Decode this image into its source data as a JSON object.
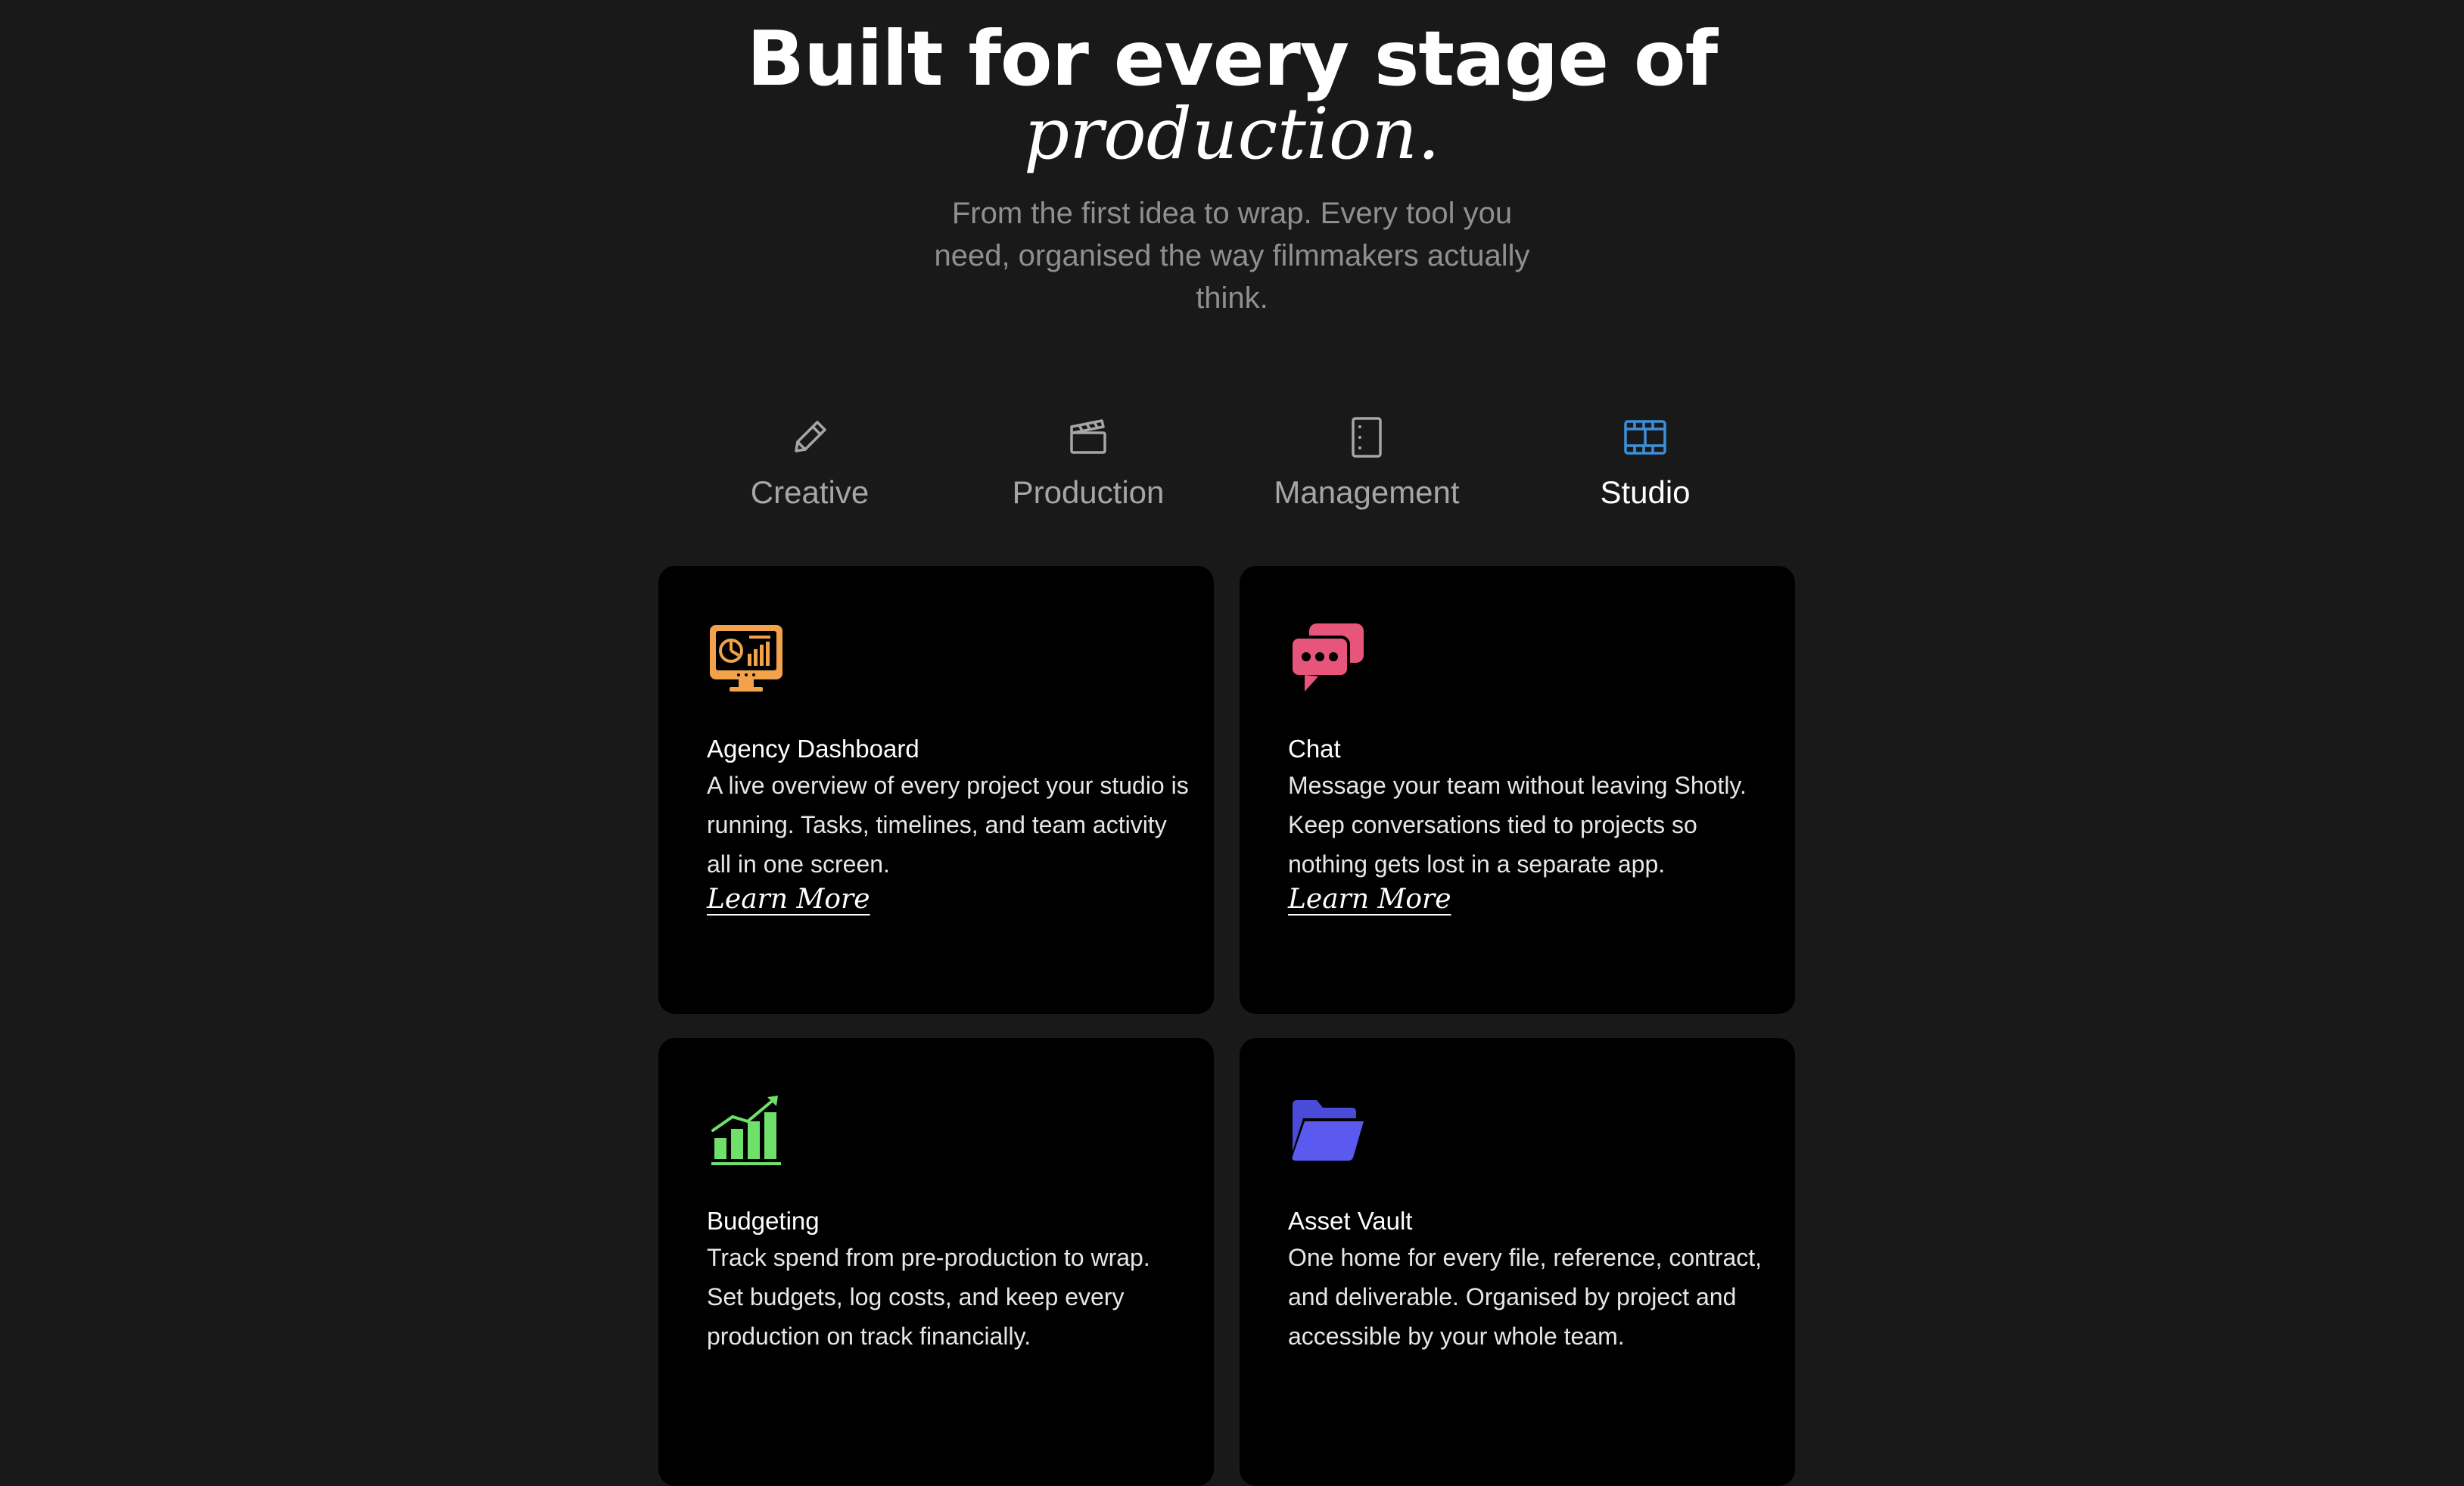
{
  "hero": {
    "title_line1": "Built for every stage of",
    "title_line2": "production.",
    "subtitle": "From the first idea to wrap. Every tool you need, organised the way filmmakers actually think."
  },
  "tabs": [
    {
      "label": "Creative",
      "icon": "pencil-icon",
      "active": false
    },
    {
      "label": "Production",
      "icon": "clapperboard-icon",
      "active": false
    },
    {
      "label": "Management",
      "icon": "document-icon",
      "active": false
    },
    {
      "label": "Studio",
      "icon": "film-icon",
      "active": true
    }
  ],
  "colors": {
    "background": "#191919",
    "card": "#000000",
    "active_tab_icon": "#3d8fd9",
    "inactive_tab": "#a6a6a6",
    "dashboard_icon": "#f2a24b",
    "chat_icon": "#e8557b",
    "budget_icon": "#6fe06a",
    "vault_icon": "#4b4bd9"
  },
  "cards": [
    {
      "icon": "dashboard-monitor-icon",
      "title": "Agency Dashboard",
      "description": "A live overview of every project your studio is running. Tasks, timelines, and team activity all in one screen.",
      "link": "Learn More"
    },
    {
      "icon": "chat-bubbles-icon",
      "title": "Chat",
      "description": "Message your team without leaving Shotly. Keep conversations tied to projects so nothing gets lost in a separate app.",
      "link": "Learn More"
    },
    {
      "icon": "growth-chart-icon",
      "title": "Budgeting",
      "description": "Track spend from pre-production to wrap. Set budgets, log costs, and keep every production on track financially."
    },
    {
      "icon": "folder-icon",
      "title": "Asset Vault",
      "description": "One home for every file, reference, contract, and deliverable. Organised by project and accessible by your whole team."
    }
  ]
}
